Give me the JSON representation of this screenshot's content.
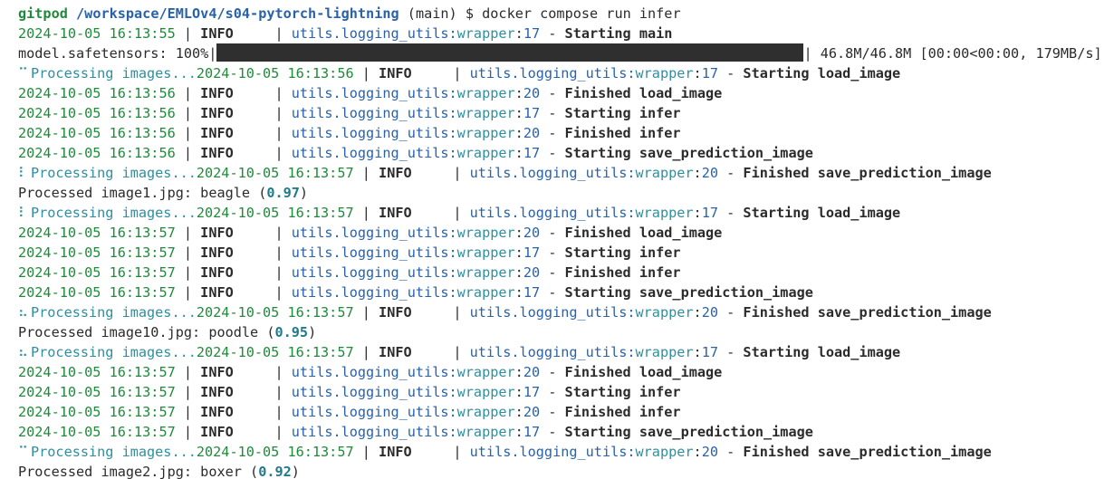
{
  "prompt": {
    "user": "gitpod",
    "path": "/workspace/EMLOv4/s04-pytorch-lightning",
    "branch": "(main)",
    "symbol": "$",
    "command": "docker compose run infer"
  },
  "progress": {
    "label": "model.safetensors: 100%|",
    "fill_fraction": 1.0,
    "stats": "| 46.8M/46.8M [00:00<00:00, 179MB/s]"
  },
  "log": {
    "level": "INFO",
    "module_prefix": "utils.logging_utils:",
    "function": "wrapper",
    "sep": " - "
  },
  "lines": [
    {
      "kind": "log",
      "ts": "2024-10-05 16:13:55",
      "lineno": "17",
      "state": "Starting",
      "target": "main"
    },
    {
      "kind": "spin",
      "spinner": "⠉",
      "ts": "2024-10-05 16:13:56",
      "lineno": "17",
      "state": "Starting",
      "target": "load_image"
    },
    {
      "kind": "log",
      "ts": "2024-10-05 16:13:56",
      "lineno": "20",
      "state": "Finished",
      "target": "load_image"
    },
    {
      "kind": "log",
      "ts": "2024-10-05 16:13:56",
      "lineno": "17",
      "state": "Starting",
      "target": "infer"
    },
    {
      "kind": "log",
      "ts": "2024-10-05 16:13:56",
      "lineno": "20",
      "state": "Finished",
      "target": "infer"
    },
    {
      "kind": "log",
      "ts": "2024-10-05 16:13:56",
      "lineno": "17",
      "state": "Starting",
      "target": "save_prediction_image"
    },
    {
      "kind": "spin",
      "spinner": "⠇",
      "ts": "2024-10-05 16:13:57",
      "lineno": "20",
      "state": "Finished",
      "target": "save_prediction_image"
    },
    {
      "kind": "result",
      "file": "image1.jpg",
      "label": "beagle",
      "score": "0.97"
    },
    {
      "kind": "spin",
      "spinner": "⠇",
      "ts": "2024-10-05 16:13:57",
      "lineno": "17",
      "state": "Starting",
      "target": "load_image"
    },
    {
      "kind": "log",
      "ts": "2024-10-05 16:13:57",
      "lineno": "20",
      "state": "Finished",
      "target": "load_image"
    },
    {
      "kind": "log",
      "ts": "2024-10-05 16:13:57",
      "lineno": "17",
      "state": "Starting",
      "target": "infer"
    },
    {
      "kind": "log",
      "ts": "2024-10-05 16:13:57",
      "lineno": "20",
      "state": "Finished",
      "target": "infer"
    },
    {
      "kind": "log",
      "ts": "2024-10-05 16:13:57",
      "lineno": "17",
      "state": "Starting",
      "target": "save_prediction_image"
    },
    {
      "kind": "spin",
      "spinner": "⠦",
      "ts": "2024-10-05 16:13:57",
      "lineno": "20",
      "state": "Finished",
      "target": "save_prediction_image"
    },
    {
      "kind": "result",
      "file": "image10.jpg",
      "label": "poodle",
      "score": "0.95"
    },
    {
      "kind": "spin",
      "spinner": "⠦",
      "ts": "2024-10-05 16:13:57",
      "lineno": "17",
      "state": "Starting",
      "target": "load_image"
    },
    {
      "kind": "log",
      "ts": "2024-10-05 16:13:57",
      "lineno": "20",
      "state": "Finished",
      "target": "load_image"
    },
    {
      "kind": "log",
      "ts": "2024-10-05 16:13:57",
      "lineno": "17",
      "state": "Starting",
      "target": "infer"
    },
    {
      "kind": "log",
      "ts": "2024-10-05 16:13:57",
      "lineno": "20",
      "state": "Finished",
      "target": "infer"
    },
    {
      "kind": "log",
      "ts": "2024-10-05 16:13:57",
      "lineno": "17",
      "state": "Starting",
      "target": "save_prediction_image"
    },
    {
      "kind": "spin",
      "spinner": "⠉",
      "ts": "2024-10-05 16:13:57",
      "lineno": "20",
      "state": "Finished",
      "target": "save_prediction_image"
    },
    {
      "kind": "result",
      "file": "image2.jpg",
      "label": "boxer",
      "score": "0.92"
    }
  ],
  "text": {
    "processing": "Processing images...",
    "processed_prefix": "Processed ",
    "colon_space": ": ",
    "pipe": " | ",
    "level_pad": "     | "
  }
}
